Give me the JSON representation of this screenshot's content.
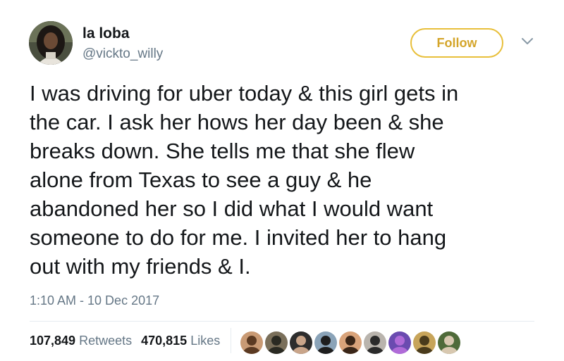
{
  "tweet": {
    "display_name": "la loba",
    "handle": "@vickto_willy",
    "follow_label": "Follow",
    "text_lines": [
      "I was driving for uber today & this girl gets in",
      "the car. I ask her hows her day been & she",
      "breaks down. She tells me that she flew",
      "alone from Texas to see a guy & he",
      "abandoned her so I did what I would want",
      "someone to do for me. I invited her to hang",
      "out with my friends & I."
    ],
    "timestamp": "1:10 AM - 10 Dec 2017",
    "retweets_count": "107,849",
    "retweets_label": "Retweets",
    "likes_count": "470,815",
    "likes_label": "Likes"
  },
  "icons": {
    "more": "chevron-down-icon"
  },
  "colors": {
    "accent": "#e8bf3a",
    "secondary_text": "#657786",
    "primary_text": "#14171a",
    "divider": "#e6ecf0"
  },
  "likers": [
    {
      "bg": "#c99a74",
      "fg": "#5b3a22"
    },
    {
      "bg": "#7a6f5a",
      "fg": "#2a2a22"
    },
    {
      "bg": "#2d2d2d",
      "fg": "#c9a58a"
    },
    {
      "bg": "#8aa3b8",
      "fg": "#1e1e1e"
    },
    {
      "bg": "#d9a37a",
      "fg": "#3a2618"
    },
    {
      "bg": "#b9b4ad",
      "fg": "#2b2b2b"
    },
    {
      "bg": "#6a4bb0",
      "fg": "#b06bd8"
    },
    {
      "bg": "#c7a45a",
      "fg": "#4a3b1c"
    },
    {
      "bg": "#4f6b3a",
      "fg": "#d8c8b0"
    }
  ]
}
